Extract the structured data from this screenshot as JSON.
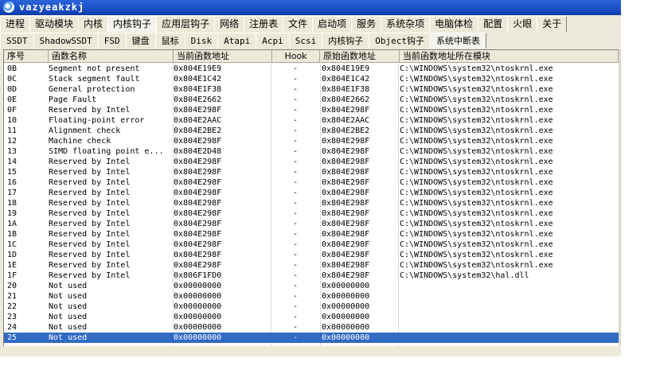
{
  "window": {
    "title": "vazyeakzkj"
  },
  "tabs_row1": [
    "进程",
    "驱动模块",
    "内核",
    "内核钩子",
    "应用层钩子",
    "网络",
    "注册表",
    "文件",
    "启动项",
    "服务",
    "系统杂项",
    "电脑体检",
    "配置",
    "火眼",
    "关于"
  ],
  "tabs_row1_active": 3,
  "tabs_row2": [
    "SSDT",
    "ShadowSSDT",
    "FSD",
    "键盘",
    "鼠标",
    "Disk",
    "Atapi",
    "Acpi",
    "Scsi",
    "内核钩子",
    "Object钩子",
    "系统中断表"
  ],
  "tabs_row2_active": 11,
  "columns": [
    "序号",
    "函数名称",
    "当前函数地址",
    "Hook",
    "原始函数地址",
    "当前函数地址所在模块"
  ],
  "rows": [
    [
      "0B",
      "Segment not present",
      "0x804E19E9",
      "-",
      "0x804E19E9",
      "C:\\WINDOWS\\system32\\ntoskrnl.exe"
    ],
    [
      "0C",
      "Stack segment fault",
      "0x804E1C42",
      "-",
      "0x804E1C42",
      "C:\\WINDOWS\\system32\\ntoskrnl.exe"
    ],
    [
      "0D",
      "General protection",
      "0x804E1F38",
      "-",
      "0x804E1F38",
      "C:\\WINDOWS\\system32\\ntoskrnl.exe"
    ],
    [
      "0E",
      "Page Fault",
      "0x804E2662",
      "-",
      "0x804E2662",
      "C:\\WINDOWS\\system32\\ntoskrnl.exe"
    ],
    [
      "0F",
      "Reserved by Intel",
      "0x804E298F",
      "-",
      "0x804E298F",
      "C:\\WINDOWS\\system32\\ntoskrnl.exe"
    ],
    [
      "10",
      "Floating-point error",
      "0x804E2AAC",
      "-",
      "0x804E2AAC",
      "C:\\WINDOWS\\system32\\ntoskrnl.exe"
    ],
    [
      "11",
      "Alignment check",
      "0x804E2BE2",
      "-",
      "0x804E2BE2",
      "C:\\WINDOWS\\system32\\ntoskrnl.exe"
    ],
    [
      "12",
      "Machine check",
      "0x804E298F",
      "-",
      "0x804E298F",
      "C:\\WINDOWS\\system32\\ntoskrnl.exe"
    ],
    [
      "13",
      "SIMD floating point e...",
      "0x804E2D48",
      "-",
      "0x804E298F",
      "C:\\WINDOWS\\system32\\ntoskrnl.exe"
    ],
    [
      "14",
      "Reserved by Intel",
      "0x804E298F",
      "-",
      "0x804E298F",
      "C:\\WINDOWS\\system32\\ntoskrnl.exe"
    ],
    [
      "15",
      "Reserved by Intel",
      "0x804E298F",
      "-",
      "0x804E298F",
      "C:\\WINDOWS\\system32\\ntoskrnl.exe"
    ],
    [
      "16",
      "Reserved by Intel",
      "0x804E298F",
      "-",
      "0x804E298F",
      "C:\\WINDOWS\\system32\\ntoskrnl.exe"
    ],
    [
      "17",
      "Reserved by Intel",
      "0x804E298F",
      "-",
      "0x804E298F",
      "C:\\WINDOWS\\system32\\ntoskrnl.exe"
    ],
    [
      "18",
      "Reserved by Intel",
      "0x804E298F",
      "-",
      "0x804E298F",
      "C:\\WINDOWS\\system32\\ntoskrnl.exe"
    ],
    [
      "19",
      "Reserved by Intel",
      "0x804E298F",
      "-",
      "0x804E298F",
      "C:\\WINDOWS\\system32\\ntoskrnl.exe"
    ],
    [
      "1A",
      "Reserved by Intel",
      "0x804E298F",
      "-",
      "0x804E298F",
      "C:\\WINDOWS\\system32\\ntoskrnl.exe"
    ],
    [
      "1B",
      "Reserved by Intel",
      "0x804E298F",
      "-",
      "0x804E298F",
      "C:\\WINDOWS\\system32\\ntoskrnl.exe"
    ],
    [
      "1C",
      "Reserved by Intel",
      "0x804E298F",
      "-",
      "0x804E298F",
      "C:\\WINDOWS\\system32\\ntoskrnl.exe"
    ],
    [
      "1D",
      "Reserved by Intel",
      "0x804E298F",
      "-",
      "0x804E298F",
      "C:\\WINDOWS\\system32\\ntoskrnl.exe"
    ],
    [
      "1E",
      "Reserved by Intel",
      "0x804E298F",
      "-",
      "0x804E298F",
      "C:\\WINDOWS\\system32\\ntoskrnl.exe"
    ],
    [
      "1F",
      "Reserved by Intel",
      "0x806F1FD0",
      "-",
      "0x804E298F",
      "C:\\WINDOWS\\system32\\hal.dll"
    ],
    [
      "20",
      "Not used",
      "0x00000000",
      "-",
      "0x00000000",
      ""
    ],
    [
      "21",
      "Not used",
      "0x00000000",
      "-",
      "0x00000000",
      ""
    ],
    [
      "22",
      "Not used",
      "0x00000000",
      "-",
      "0x00000000",
      ""
    ],
    [
      "23",
      "Not used",
      "0x00000000",
      "-",
      "0x00000000",
      ""
    ],
    [
      "24",
      "Not used",
      "0x00000000",
      "-",
      "0x00000000",
      ""
    ],
    [
      "25",
      "Not used",
      "0x00000000",
      "-",
      "0x00000000",
      ""
    ]
  ],
  "selected_row": 26
}
